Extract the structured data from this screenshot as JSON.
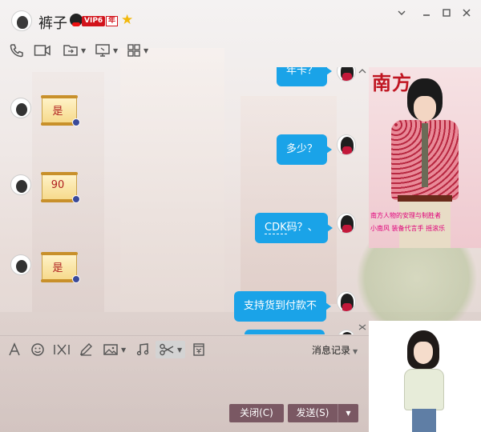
{
  "window": {
    "contact_name": "裤子",
    "vip_label": "VIP6",
    "year_label": "年",
    "controls": [
      "chevron-down",
      "minimize",
      "maximize",
      "close"
    ]
  },
  "toolbar": {
    "items": [
      "phone-icon",
      "video-icon",
      "share-file-icon",
      "remote-desktop-icon",
      "app-grid-icon"
    ]
  },
  "messages": [
    {
      "side": "out",
      "text": "年卡？",
      "partial": true
    },
    {
      "side": "in",
      "text": "是"
    },
    {
      "side": "out",
      "text": "多少？"
    },
    {
      "side": "in",
      "text": "90"
    },
    {
      "side": "out",
      "text": "CDK码？、",
      "underline": "CDK"
    },
    {
      "side": "in",
      "text": "是"
    },
    {
      "side": "out",
      "text": "支持货到付款不"
    },
    {
      "side": "out",
      "text": "",
      "partial": true
    }
  ],
  "right_panel": {
    "magazine_title": "南方",
    "magazine_line1": "南方人物的安理与制胜者",
    "magazine_line2": "小南风 装备代言手 摇滚乐"
  },
  "input_toolbar": {
    "items": [
      "font-icon",
      "emoji-icon",
      "gif-icon",
      "pen-icon",
      "image-icon",
      "music-icon",
      "scissors-icon",
      "red-packet-icon"
    ],
    "history_label": "消息记录"
  },
  "buttons": {
    "close_label": "关闭(C)",
    "send_label": "发送(S)"
  }
}
